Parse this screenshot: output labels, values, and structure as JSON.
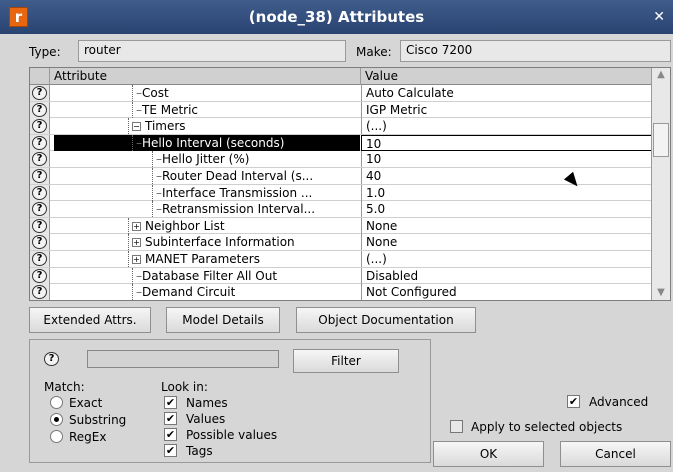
{
  "window": {
    "title": "(node_38) Attributes",
    "icon_letter": "r"
  },
  "header": {
    "type_label": "Type:",
    "type_value": "router",
    "make_label": "Make:",
    "make_value": "Cisco 7200"
  },
  "grid": {
    "col_attribute": "Attribute",
    "col_value": "Value",
    "rows": [
      {
        "attr": "Cost",
        "value": "Auto Calculate"
      },
      {
        "attr": "TE Metric",
        "value": "IGP Metric"
      },
      {
        "attr": "Timers",
        "value": "(...)",
        "expander": "⊟"
      },
      {
        "attr": "Hello Interval (seconds)",
        "value": "10"
      },
      {
        "attr": "Hello Jitter (%)",
        "value": "10"
      },
      {
        "attr": "Router Dead Interval (s...",
        "value": "40"
      },
      {
        "attr": "Interface Transmission ...",
        "value": "1.0"
      },
      {
        "attr": "Retransmission Interval...",
        "value": "5.0"
      },
      {
        "attr": "Neighbor List",
        "value": "None",
        "expander": "⊞"
      },
      {
        "attr": "Subinterface Information",
        "value": "None",
        "expander": "⊞"
      },
      {
        "attr": "MANET Parameters",
        "value": "(...)",
        "expander": "⊞"
      },
      {
        "attr": "Database Filter All Out",
        "value": "Disabled"
      },
      {
        "attr": "Demand Circuit",
        "value": "Not Configured"
      }
    ]
  },
  "buttons": {
    "extended_attrs": "Extended Attrs.",
    "model_details": "Model Details",
    "object_documentation": "Object Documentation",
    "filter": "Filter",
    "ok": "OK",
    "cancel": "Cancel"
  },
  "find": {
    "match_label": "Match:",
    "look_in_label": "Look in:",
    "match_options": [
      "Exact",
      "Substring",
      "RegEx"
    ],
    "look_in_options": [
      "Names",
      "Values",
      "Possible values",
      "Tags"
    ],
    "search_value": ""
  },
  "options": {
    "advanced": "Advanced",
    "apply_selected": "Apply to selected objects"
  }
}
